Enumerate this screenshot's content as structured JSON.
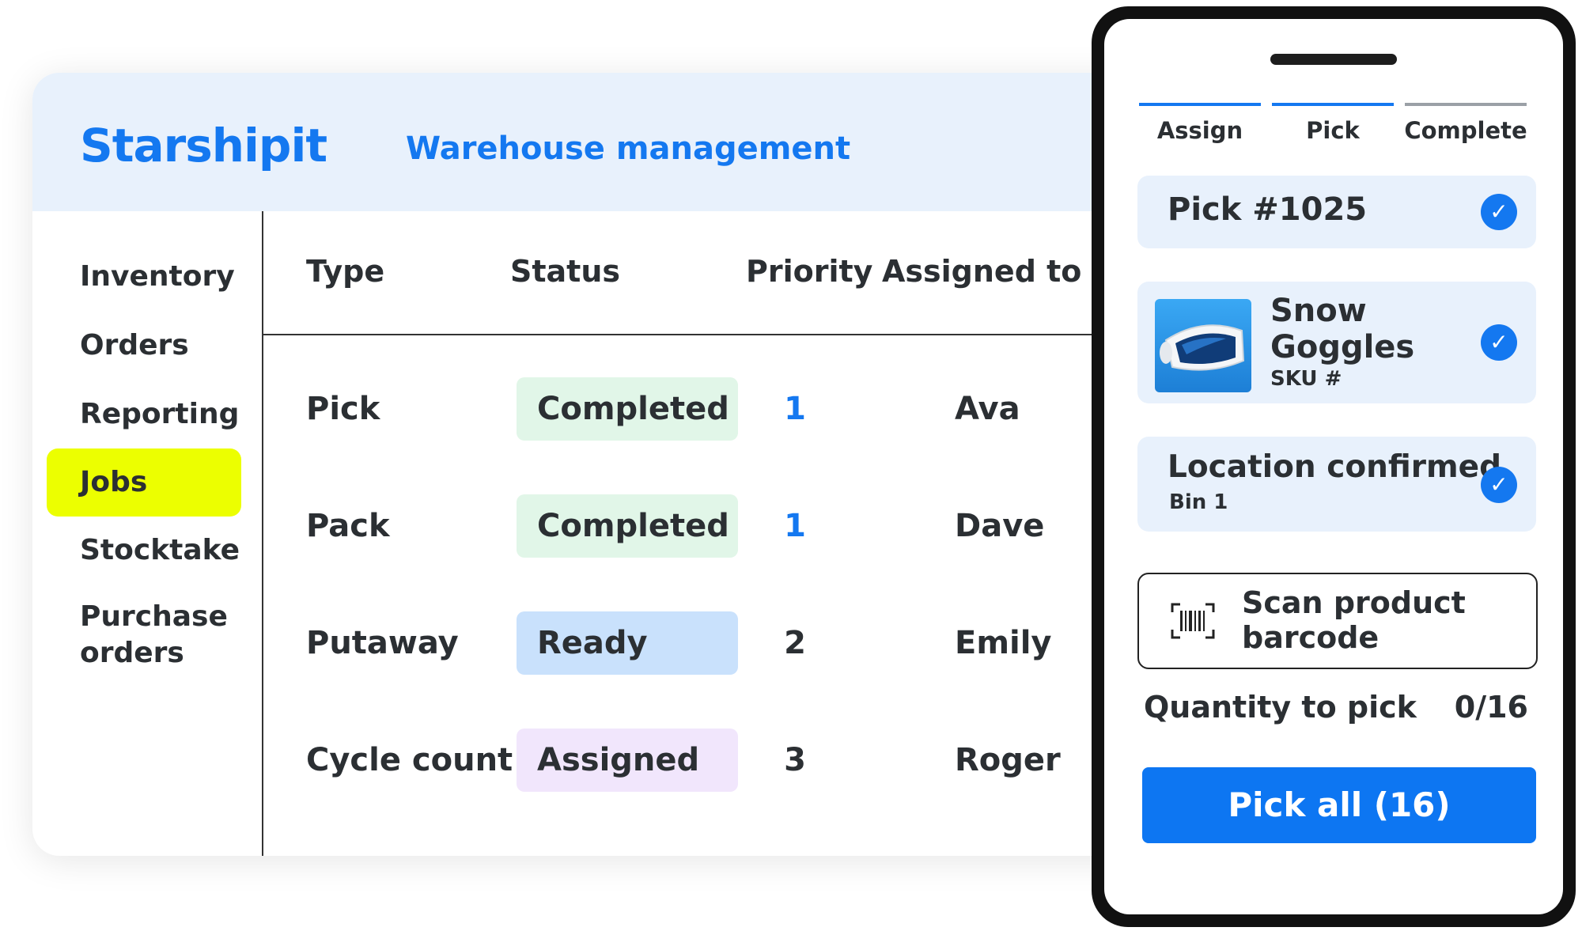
{
  "app": {
    "brand": "Starshipit",
    "product": "Warehouse management"
  },
  "sidebar": {
    "items": [
      {
        "label": "Inventory",
        "active": false
      },
      {
        "label": "Orders",
        "active": false
      },
      {
        "label": "Reporting",
        "active": false
      },
      {
        "label": "Jobs",
        "active": true
      },
      {
        "label": "Stocktake",
        "active": false
      },
      {
        "label": "Purchase orders",
        "active": false
      }
    ]
  },
  "table": {
    "columns": [
      "Type",
      "Status",
      "Priority",
      "Assigned to"
    ],
    "rows": [
      {
        "type": "Pick",
        "status": "Completed",
        "priority": "1",
        "assigned": "Ava",
        "status_color": "#e1f6e8",
        "priority_color": "#1478f0"
      },
      {
        "type": "Pack",
        "status": "Completed",
        "priority": "1",
        "assigned": "Dave",
        "status_color": "#e1f6e8",
        "priority_color": "#1478f0"
      },
      {
        "type": "Putaway",
        "status": "Ready",
        "priority": "2",
        "assigned": "Emily",
        "status_color": "#c9e1fc",
        "priority_color": "#2b2f33"
      },
      {
        "type": "Cycle count",
        "status": "Assigned",
        "priority": "3",
        "assigned": "Roger",
        "status_color": "#f1e6fc",
        "priority_color": "#2b2f33"
      }
    ]
  },
  "mobile": {
    "steps": [
      {
        "label": "Assign",
        "state": "done"
      },
      {
        "label": "Pick",
        "state": "active"
      },
      {
        "label": "Complete",
        "state": "pending"
      }
    ],
    "pick_card": {
      "title": "Pick #1025"
    },
    "product_card": {
      "name_line1": "Snow",
      "name_line2": "Goggles",
      "sku": "SKU #"
    },
    "location_card": {
      "title": "Location confirmed",
      "subtitle": "Bin 1"
    },
    "scan_card": {
      "line1": "Scan product",
      "line2": "barcode",
      "icon": "barcode-icon"
    },
    "quantity": {
      "label": "Quantity to pick",
      "value": "0/16",
      "picked": 0,
      "total": 16
    },
    "pick_all_button": "Pick all (16)"
  },
  "colors": {
    "brand_blue": "#1478f0",
    "header_bg": "#e8f1fc",
    "active_nav": "#ecff00",
    "step_done": "#1478f0",
    "step_pending": "#9aa0a6"
  }
}
